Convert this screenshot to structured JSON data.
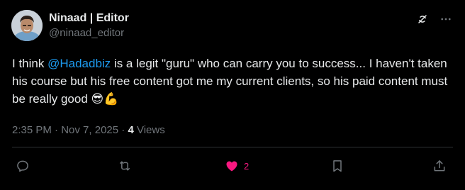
{
  "author": {
    "display_name": "Ninaad | Editor",
    "handle": "@ninaad_editor"
  },
  "top_actions": {
    "grok_icon": "grok-icon",
    "more_icon": "more-icon"
  },
  "post": {
    "text_before": "I think ",
    "mention": "@Hadadbiz",
    "text_after": " is a legit \"guru\" who can carry you to success... I haven't taken his course but his free content got me my current clients, so his paid content must be really good ",
    "emoji": "😎💪"
  },
  "meta": {
    "time": "2:35 PM",
    "separator": " · ",
    "date": "Nov 7, 2025",
    "views_count": "4",
    "views_label": " Views"
  },
  "actions": {
    "reply_icon": "reply-icon",
    "repost_icon": "repost-icon",
    "like_icon": "heart-filled-icon",
    "like_count": "2",
    "bookmark_icon": "bookmark-icon",
    "share_icon": "share-icon"
  },
  "colors": {
    "background": "#000000",
    "text": "#e7e9ea",
    "secondary": "#71767b",
    "link": "#1d9bf0",
    "like": "#f91880"
  }
}
